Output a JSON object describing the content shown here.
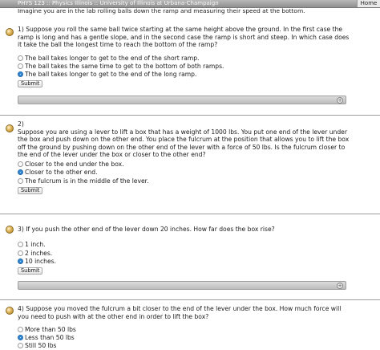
{
  "window": {
    "title": "PHYS 123 :: Physics Illinois :: University of Illinois at Urbana-Champaign",
    "home": "Home"
  },
  "intro": "Imagine you are in the lab rolling balls down the ramp and measuring their speed at the bottom.",
  "questions": [
    {
      "text": "1) Suppose you roll the same ball twice starting at the same height above the ground. In the first case the ramp is long and has a gentle slope, and in the second case the ramp is short and steep. In which case does it take the ball the longest time to reach the bottom of the ramp?",
      "options": [
        "The ball takes longer to get to the end of the short ramp.",
        "The ball takes the same time to get to the bottom of both ramps.",
        "The ball takes longer to get to the end of the long ramp."
      ],
      "selected": 2,
      "submit": "Submit"
    },
    {
      "text": "2)\nSuppose you are using a lever to lift a box that has a weight of 1000 lbs. You put one end of the lever under the box and push down on the other end. You place the fulcrum at the position that allows you to lift the box off the ground by pushing down on the other end of the lever with a force of 50 lbs. Is the fulcrum closer to the end of the lever under the box or closer to the other end?",
      "options": [
        "Closer to the end under the box.",
        "Closer to the other end.",
        "The fulcrum is in the middle of the lever."
      ],
      "selected": 1,
      "submit": "Submit"
    },
    {
      "text": "3) If you push the other end of the lever down 20 inches. How far does the box rise?",
      "options": [
        "1 inch.",
        "2 inches.",
        "10 inches."
      ],
      "selected": 2,
      "submit": "Submit"
    },
    {
      "text": "4) Suppose you moved the fulcrum a bit closer to the end of the lever under the box. How much force will you need to push with at the other end in order to lift the box?",
      "options": [
        "More than 50 lbs",
        "Less than 50 lbs",
        "Still 50 lbs"
      ],
      "selected": 1
    }
  ],
  "feedback_toggle": "+"
}
